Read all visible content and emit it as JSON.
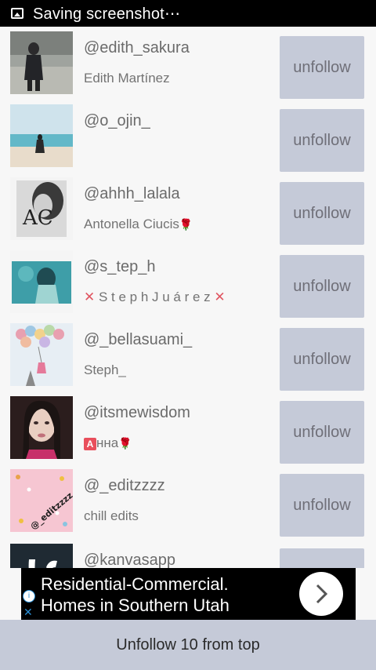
{
  "status_bar": {
    "text": "Saving screenshot⋯"
  },
  "list": [
    {
      "username": "@edith_sakura",
      "name": "Edith Martínez",
      "button": "unfollow"
    },
    {
      "username": "@o_ojin_",
      "name": "",
      "button": "unfollow"
    },
    {
      "username": "@ahhh_lalala",
      "name": "Antonella Ciucis",
      "name_suffix": "🌹",
      "button": "unfollow"
    },
    {
      "username": "@s_tep_h",
      "name": "S t e p h  J u á r e z",
      "name_prefix": "✕",
      "name_suffix": "✕",
      "button": "unfollow"
    },
    {
      "username": "@_bellasuami_",
      "name": "Steph_",
      "button": "unfollow"
    },
    {
      "username": "@itsmewisdom",
      "name_badge": "A",
      "name": "нна",
      "name_suffix": "🌹",
      "button": "unfollow"
    },
    {
      "username": "@_editzzzz",
      "name": "chill edits",
      "thumb_text": "@_editzzzz",
      "button": "unfollow"
    },
    {
      "username": "@kanvasapp",
      "name": "",
      "button": ""
    }
  ],
  "ad": {
    "line1": "Residential-Commercial.",
    "line2": "Homes in Southern Utah",
    "info": "i",
    "close": "✕"
  },
  "bottom_button": {
    "label": "Unfollow 10 from top"
  },
  "colors": {
    "button_bg": "#c5cad8",
    "status_bar": "#000000",
    "accent_x": "#e05561"
  }
}
